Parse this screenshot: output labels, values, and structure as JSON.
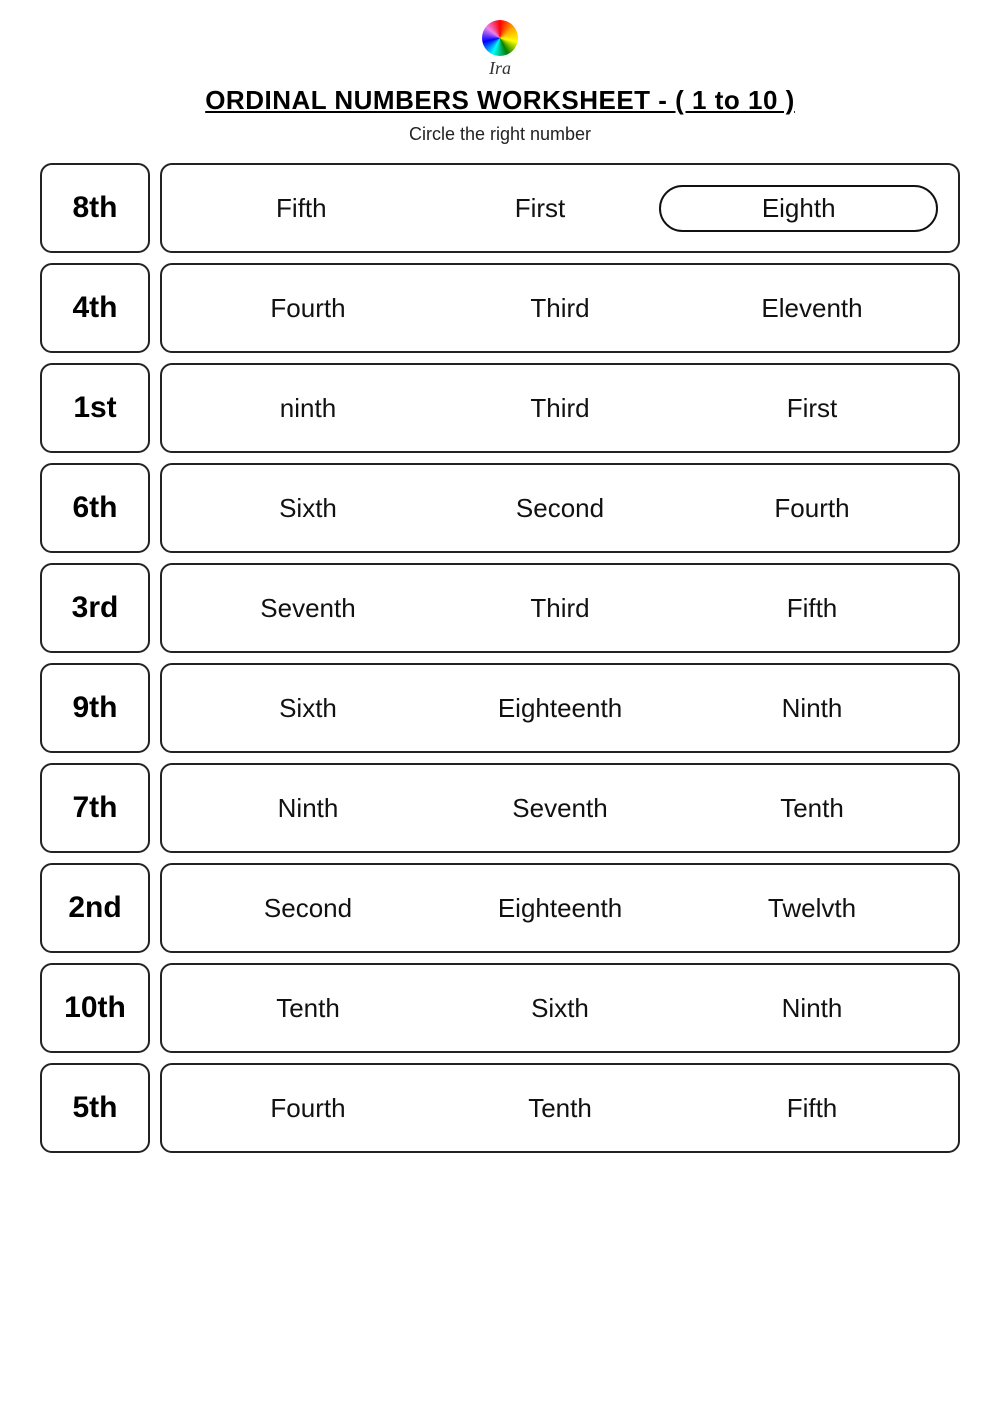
{
  "logo": {
    "text": "Ira"
  },
  "title": "ORDINAL NUMBERS WORKSHEET - ( 1 to 10 )",
  "subtitle": "Circle the right number",
  "rows": [
    {
      "number": "8th",
      "options": [
        {
          "text": "Fifth",
          "circled": false
        },
        {
          "text": "First",
          "circled": false
        },
        {
          "text": "Eighth",
          "circled": true
        }
      ]
    },
    {
      "number": "4th",
      "options": [
        {
          "text": "Fourth",
          "circled": false
        },
        {
          "text": "Third",
          "circled": false
        },
        {
          "text": "Eleventh",
          "circled": false
        }
      ]
    },
    {
      "number": "1st",
      "options": [
        {
          "text": "ninth",
          "circled": false
        },
        {
          "text": "Third",
          "circled": false
        },
        {
          "text": "First",
          "circled": false
        }
      ]
    },
    {
      "number": "6th",
      "options": [
        {
          "text": "Sixth",
          "circled": false
        },
        {
          "text": "Second",
          "circled": false
        },
        {
          "text": "Fourth",
          "circled": false
        }
      ]
    },
    {
      "number": "3rd",
      "options": [
        {
          "text": "Seventh",
          "circled": false
        },
        {
          "text": "Third",
          "circled": false
        },
        {
          "text": "Fifth",
          "circled": false
        }
      ]
    },
    {
      "number": "9th",
      "options": [
        {
          "text": "Sixth",
          "circled": false
        },
        {
          "text": "Eighteenth",
          "circled": false
        },
        {
          "text": "Ninth",
          "circled": false
        }
      ]
    },
    {
      "number": "7th",
      "options": [
        {
          "text": "Ninth",
          "circled": false
        },
        {
          "text": "Seventh",
          "circled": false
        },
        {
          "text": "Tenth",
          "circled": false
        }
      ]
    },
    {
      "number": "2nd",
      "options": [
        {
          "text": "Second",
          "circled": false
        },
        {
          "text": "Eighteenth",
          "circled": false
        },
        {
          "text": "Twelvth",
          "circled": false
        }
      ]
    },
    {
      "number": "10th",
      "options": [
        {
          "text": "Tenth",
          "circled": false
        },
        {
          "text": "Sixth",
          "circled": false
        },
        {
          "text": "Ninth",
          "circled": false
        }
      ]
    },
    {
      "number": "5th",
      "options": [
        {
          "text": "Fourth",
          "circled": false
        },
        {
          "text": "Tenth",
          "circled": false
        },
        {
          "text": "Fifth",
          "circled": false
        }
      ]
    }
  ]
}
